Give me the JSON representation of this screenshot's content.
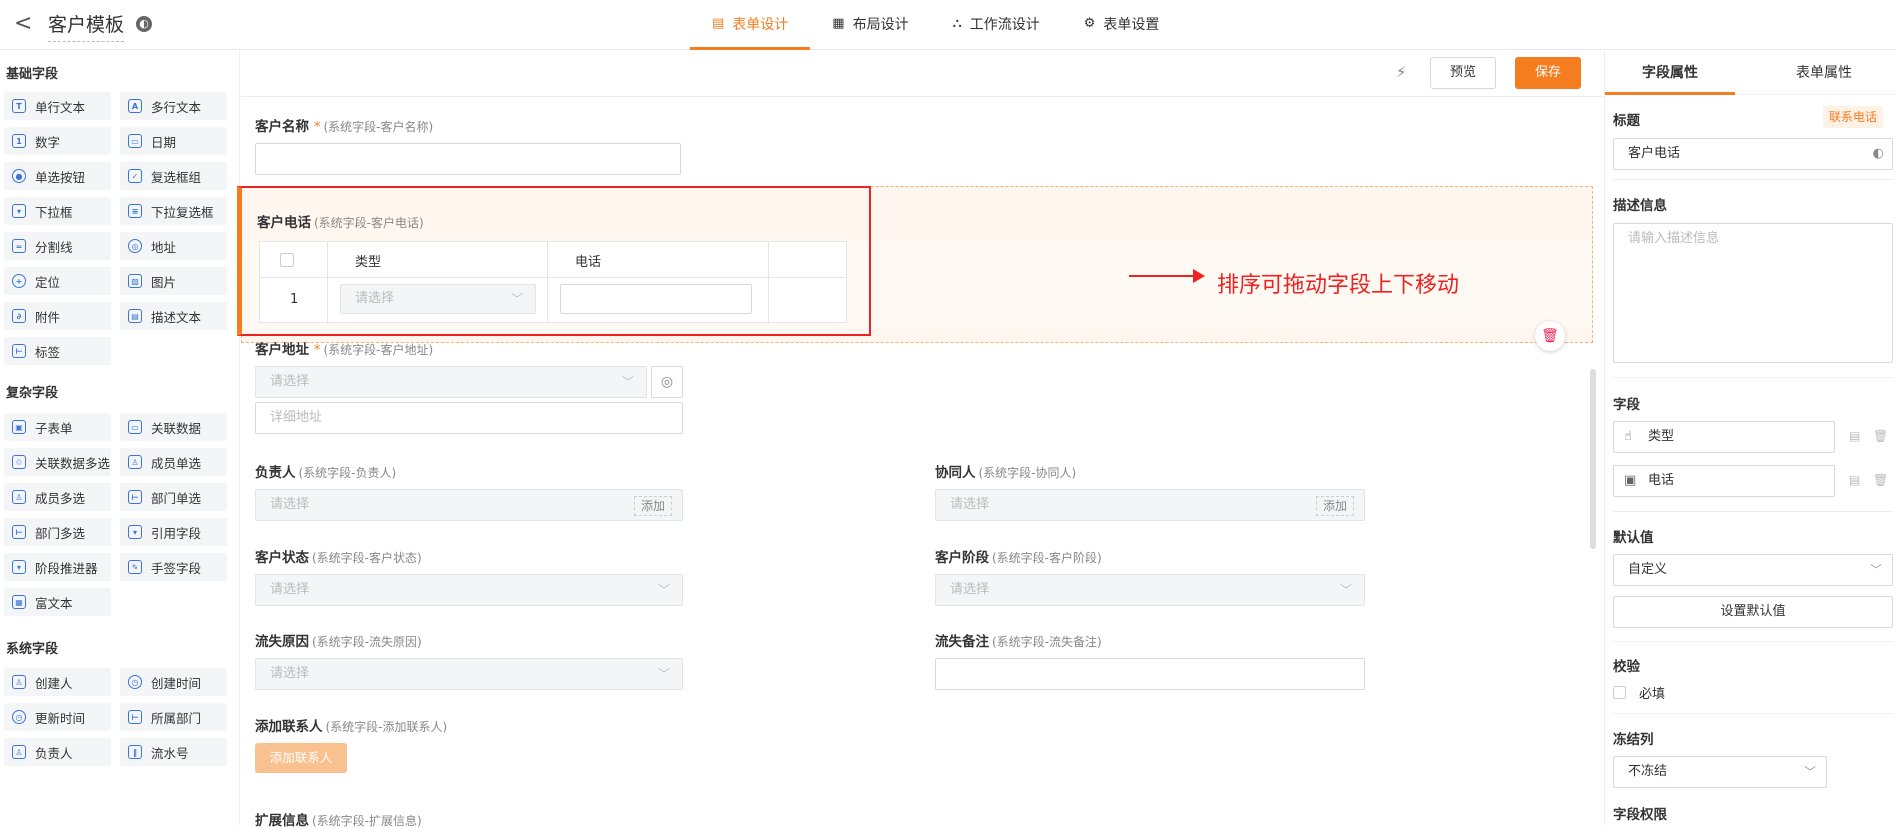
{
  "header": {
    "back": "<",
    "title": "客户模板",
    "tabs": [
      {
        "label": "表单设计",
        "icon": "▤"
      },
      {
        "label": "布局设计",
        "icon": "▦"
      },
      {
        "label": "工作流设计",
        "icon": "⛬"
      },
      {
        "label": "表单设置",
        "icon": "⚙"
      }
    ]
  },
  "left": {
    "groups": [
      "基础字段",
      "复杂字段",
      "系统字段"
    ],
    "basic": [
      {
        "label": "单行文本",
        "icon": "T"
      },
      {
        "label": "多行文本",
        "icon": "A"
      },
      {
        "label": "数字",
        "icon": "1"
      },
      {
        "label": "日期",
        "icon": "▭"
      },
      {
        "label": "单选按钮",
        "icon": "●"
      },
      {
        "label": "复选框组",
        "icon": "✓"
      },
      {
        "label": "下拉框",
        "icon": "▾"
      },
      {
        "label": "下拉复选框",
        "icon": "≡"
      },
      {
        "label": "分割线",
        "icon": "="
      },
      {
        "label": "地址",
        "icon": "◎"
      },
      {
        "label": "定位",
        "icon": "+"
      },
      {
        "label": "图片",
        "icon": "▨"
      },
      {
        "label": "附件",
        "icon": "∂"
      },
      {
        "label": "描述文本",
        "icon": "▤"
      },
      {
        "label": "标签",
        "icon": "⊢"
      }
    ],
    "complex": [
      {
        "label": "子表单",
        "icon": "▣"
      },
      {
        "label": "关联数据",
        "icon": "▭"
      },
      {
        "label": "关联数据多选",
        "icon": "♲"
      },
      {
        "label": "成员单选",
        "icon": "♙"
      },
      {
        "label": "成员多选",
        "icon": "♙"
      },
      {
        "label": "部门单选",
        "icon": "⊢"
      },
      {
        "label": "部门多选",
        "icon": "⊢"
      },
      {
        "label": "引用字段",
        "icon": "▾"
      },
      {
        "label": "阶段推进器",
        "icon": "▾"
      },
      {
        "label": "手签字段",
        "icon": "✎"
      },
      {
        "label": "富文本",
        "icon": "▦"
      }
    ],
    "system": [
      {
        "label": "创建人",
        "icon": "♙"
      },
      {
        "label": "创建时间",
        "icon": "◷"
      },
      {
        "label": "更新时间",
        "icon": "◷"
      },
      {
        "label": "所属部门",
        "icon": "⊢"
      },
      {
        "label": "负责人",
        "icon": "♙"
      },
      {
        "label": "流水号",
        "icon": "‖"
      }
    ]
  },
  "toolbar": {
    "magic_icon": "⚡",
    "preview": "预览",
    "save": "保存"
  },
  "form": {
    "name": {
      "label": "客户名称",
      "star": "*",
      "sub": "(系统字段-客户名称)"
    },
    "phone": {
      "label": "客户电话",
      "sub": "(系统字段-客户电话)",
      "col_type": "类型",
      "col_phone": "电话",
      "row_no": "1",
      "select_ph": "请选择"
    },
    "address": {
      "label": "客户地址",
      "star": "*",
      "sub": "(系统字段-客户地址)",
      "select_ph": "请选择",
      "detail_ph": "详细地址"
    },
    "owner": {
      "label": "负责人",
      "sub": "(系统字段-负责人)",
      "ph": "请选择",
      "add": "添加"
    },
    "collab": {
      "label": "协同人",
      "sub": "(系统字段-协同人)",
      "ph": "请选择",
      "add": "添加"
    },
    "status": {
      "label": "客户状态",
      "sub": "(系统字段-客户状态)",
      "ph": "请选择"
    },
    "stage": {
      "label": "客户阶段",
      "sub": "(系统字段-客户阶段)",
      "ph": "请选择"
    },
    "loss_reason": {
      "label": "流失原因",
      "sub": "(系统字段-流失原因)",
      "ph": "请选择"
    },
    "loss_note": {
      "label": "流失备注",
      "sub": "(系统字段-流失备注)"
    },
    "contact": {
      "label": "添加联系人",
      "sub": "(系统字段-添加联系人)",
      "btn": "添加联系人"
    },
    "ext": {
      "label": "扩展信息",
      "sub": "(系统字段-扩展信息)"
    }
  },
  "annotation": "排序可拖动字段上下移动",
  "right": {
    "tabs": [
      "字段属性",
      "表单属性"
    ],
    "title_label": "标题",
    "badge": "联系电话",
    "title_value": "客户电话",
    "desc_label": "描述信息",
    "desc_ph": "请输入描述信息",
    "fields_label": "字段",
    "fields": [
      {
        "label": "类型",
        "icon": "☝"
      },
      {
        "label": "电话",
        "icon": "▣"
      }
    ],
    "default_label": "默认值",
    "default_value": "自定义",
    "set_default": "设置默认值",
    "verify_label": "校验",
    "required": "必填",
    "freeze_label": "冻结列",
    "freeze_value": "不冻结",
    "perm_label": "字段权限"
  },
  "colors": {
    "accent": "#f57c1f",
    "annotation": "#e22222"
  }
}
